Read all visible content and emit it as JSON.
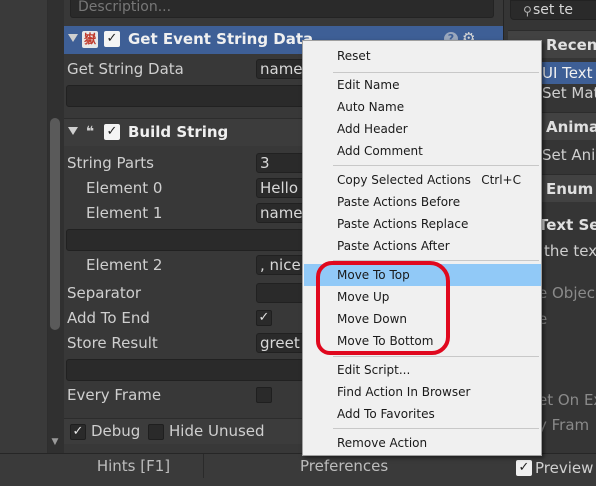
{
  "inspector": {
    "description_placeholder": "Description...",
    "action1": {
      "title": "Get Event String Data",
      "icon": "嶽",
      "field_label": "Get String Data",
      "field_value": "name"
    },
    "action2": {
      "title": "Build String",
      "icon": "❝",
      "rows": [
        {
          "label": "String Parts",
          "value": "3"
        },
        {
          "label": "Element 0",
          "value": "Hello"
        },
        {
          "label": "Element 1",
          "value": "name"
        },
        {
          "label": "Element 2",
          "value": ", nice"
        },
        {
          "label": "Separator",
          "value": ""
        },
        {
          "label": "Add To End",
          "value": "✓"
        },
        {
          "label": "Store Result",
          "value": "greet"
        },
        {
          "label": "Every Frame",
          "value": ""
        }
      ]
    },
    "bottom": {
      "debug_label": "Debug",
      "debug_checked": "✓",
      "hide_unused_label": "Hide Unused"
    }
  },
  "footer": {
    "hints_label": "Hints [F1]",
    "preferences_label": "Preferences"
  },
  "right_panel": {
    "search_value": "set te",
    "search_icon": "search-icon",
    "categories": [
      {
        "label": "Recent",
        "icon": "clock-icon"
      },
      {
        "label": "Anima",
        "icon": "animation-icon"
      },
      {
        "label": "Enum",
        "icon": "enum-icon"
      }
    ],
    "items": {
      "ui_text": "UI Text",
      "set_mat": "Set Mat",
      "set_anim": "Set Anim",
      "text_set": "Text Set",
      "the_text": "the tex",
      "object": "e Objec",
      "e": "e",
      "et_on": "et On Ex",
      "y_fram": "y Fram"
    },
    "preview_label": "Preview"
  },
  "context_menu": {
    "items": [
      {
        "label": "Reset",
        "shortcut": ""
      },
      {
        "label": "Edit Name",
        "shortcut": ""
      },
      {
        "label": "Auto Name",
        "shortcut": ""
      },
      {
        "label": "Add Header",
        "shortcut": ""
      },
      {
        "label": "Add Comment",
        "shortcut": ""
      },
      {
        "label": "Copy Selected Actions",
        "shortcut": "Ctrl+C"
      },
      {
        "label": "Paste Actions Before",
        "shortcut": ""
      },
      {
        "label": "Paste Actions Replace",
        "shortcut": ""
      },
      {
        "label": "Paste Actions After",
        "shortcut": ""
      },
      {
        "label": "Move To Top",
        "shortcut": ""
      },
      {
        "label": "Move Up",
        "shortcut": ""
      },
      {
        "label": "Move Down",
        "shortcut": ""
      },
      {
        "label": "Move To Bottom",
        "shortcut": ""
      },
      {
        "label": "Edit Script...",
        "shortcut": ""
      },
      {
        "label": "Find Action In Browser",
        "shortcut": ""
      },
      {
        "label": "Add To Favorites",
        "shortcut": ""
      },
      {
        "label": "Remove Action",
        "shortcut": ""
      }
    ],
    "highlighted_item": "Move To Top",
    "highlight_color": "#91c9f7",
    "annotation_color": "#e0081e"
  }
}
